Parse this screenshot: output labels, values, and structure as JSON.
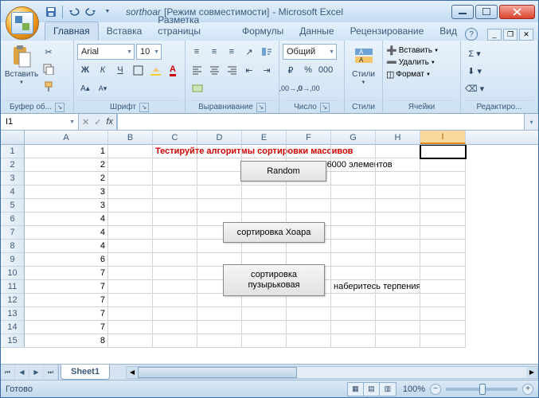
{
  "titlebar": {
    "doc": "sorthoar",
    "mode": "[Режим совместимости]",
    "app": "- Microsoft Excel"
  },
  "tabs": [
    "Главная",
    "Вставка",
    "Разметка страницы",
    "Формулы",
    "Данные",
    "Рецензирование",
    "Вид"
  ],
  "active_tab": 0,
  "ribbon": {
    "clipboard": {
      "label": "Буфер об...",
      "paste": "Вставить"
    },
    "font": {
      "label": "Шрифт",
      "name": "Arial",
      "size": "10"
    },
    "align": {
      "label": "Выравнивание"
    },
    "number": {
      "label": "Число",
      "format": "Общий"
    },
    "styles": {
      "label": "Стили",
      "btn": "Стили"
    },
    "cells": {
      "label": "Ячейки",
      "insert": "Вставить",
      "delete": "Удалить",
      "format": "Формат"
    },
    "editing": {
      "label": "Редактиро..."
    }
  },
  "namebox": "I1",
  "formula": "",
  "columns": [
    "A",
    "B",
    "C",
    "D",
    "E",
    "F",
    "G",
    "H",
    "I"
  ],
  "active_col_index": 8,
  "row_values": [
    "1",
    "2",
    "2",
    "3",
    "3",
    "4",
    "4",
    "4",
    "6",
    "7",
    "7",
    "7",
    "7",
    "7",
    "8"
  ],
  "title_text": "Тестируйте алгоритмы сортировки массивов",
  "info_text": "Массив 16000 элементов",
  "patience_text": "наберитесь терпения",
  "buttons": {
    "random": "Random",
    "hoare": "сортировка  Хоара",
    "bubble_l1": "сортировка",
    "bubble_l2": "пузырьковая"
  },
  "sheet_tab": "Sheet1",
  "status": {
    "ready": "Готово",
    "zoom": "100%"
  }
}
